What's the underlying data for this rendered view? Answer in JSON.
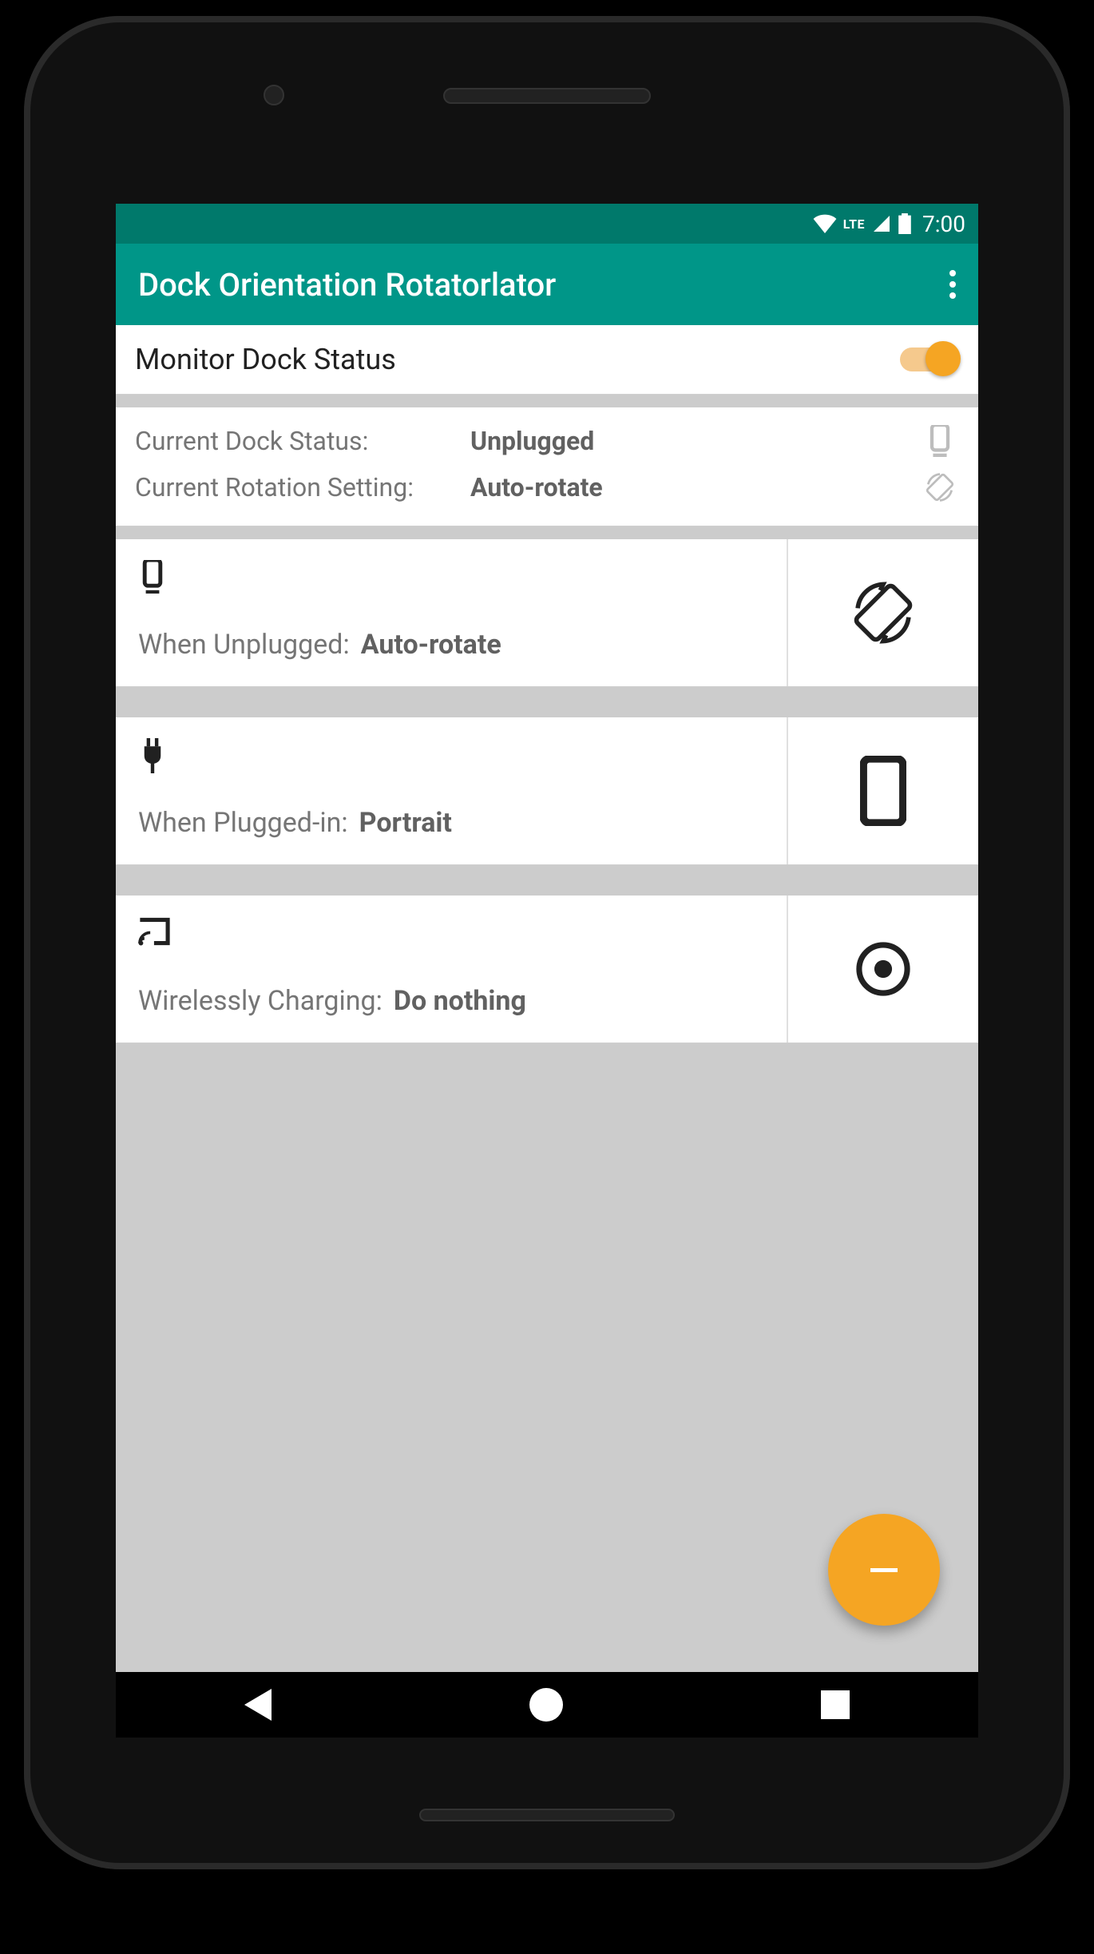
{
  "status_bar": {
    "network_label": "LTE",
    "time": "7:00"
  },
  "app_bar": {
    "title": "Dock Orientation Rotatorlator"
  },
  "monitor": {
    "label": "Monitor Dock Status",
    "enabled": true
  },
  "current": {
    "dock_status_label": "Current Dock Status:",
    "dock_status_value": "Unplugged",
    "rotation_label": "Current Rotation Setting:",
    "rotation_value": "Auto-rotate"
  },
  "settings": [
    {
      "icon": "dock-icon",
      "label": "When Unplugged:",
      "value": "Auto-rotate",
      "action_icon": "auto-rotate-icon"
    },
    {
      "icon": "plug-icon",
      "label": "When Plugged-in:",
      "value": "Portrait",
      "action_icon": "portrait-icon"
    },
    {
      "icon": "cast-icon",
      "label": "Wirelessly Charging:",
      "value": "Do nothing",
      "action_icon": "do-nothing-icon"
    }
  ],
  "fab": {
    "action": "minimize"
  },
  "colors": {
    "primary": "#009688",
    "primary_dark": "#00796b",
    "accent": "#f5a523"
  }
}
